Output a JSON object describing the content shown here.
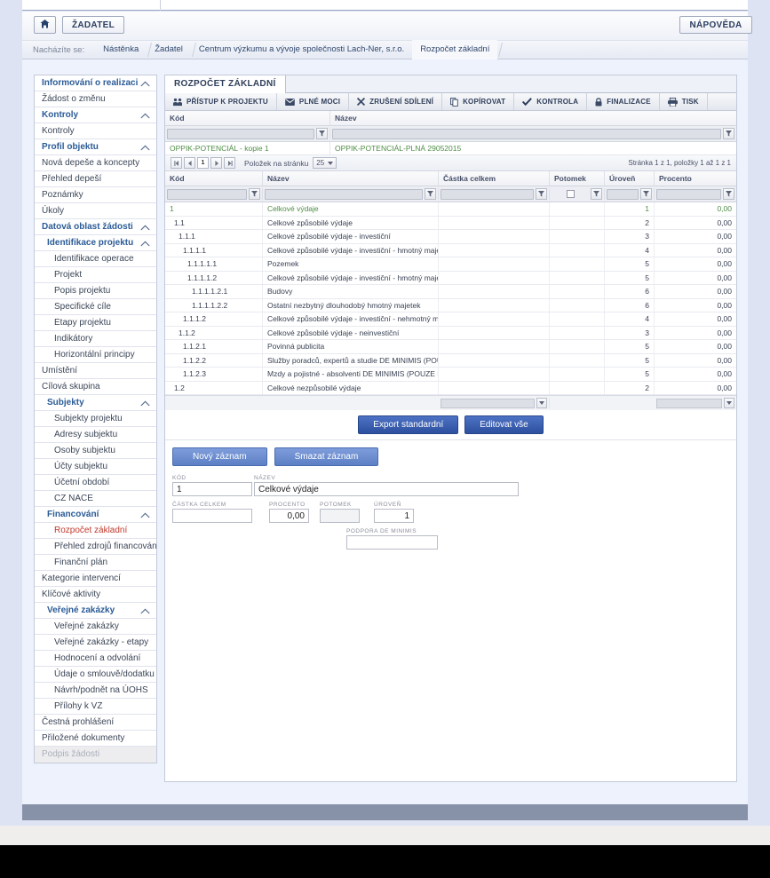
{
  "topbar": {
    "home_label": "⌂",
    "applicant_label": "ŽADATEL",
    "help_label": "NÁPOVĚDA"
  },
  "breadcrumb": {
    "label": "Nacházíte se:",
    "items": [
      "Nástěnka",
      "Žadatel",
      "Centrum výzkumu a vývoje společnosti Lach-Ner, s.r.o.",
      "Rozpočet základní"
    ]
  },
  "sidebar": {
    "items": [
      {
        "label": "Informování o realizaci",
        "type": "group",
        "chevron": true
      },
      {
        "label": "Žádost o změnu",
        "type": "item"
      },
      {
        "label": "Kontroly",
        "type": "group",
        "chevron": true
      },
      {
        "label": "Kontroly",
        "type": "item"
      },
      {
        "label": "Profil objektu",
        "type": "group",
        "chevron": true
      },
      {
        "label": "Nová depeše a koncepty",
        "type": "item"
      },
      {
        "label": "Přehled depeší",
        "type": "item"
      },
      {
        "label": "Poznámky",
        "type": "item"
      },
      {
        "label": "Úkoly",
        "type": "item"
      },
      {
        "label": "Datová oblast žádosti",
        "type": "group",
        "chevron": true
      },
      {
        "label": "Identifikace projektu",
        "type": "group-sub",
        "chevron": true
      },
      {
        "label": "Identifikace operace",
        "type": "sub"
      },
      {
        "label": "Projekt",
        "type": "sub"
      },
      {
        "label": "Popis projektu",
        "type": "sub"
      },
      {
        "label": "Specifické cíle",
        "type": "sub"
      },
      {
        "label": "Etapy projektu",
        "type": "sub"
      },
      {
        "label": "Indikátory",
        "type": "sub"
      },
      {
        "label": "Horizontální principy",
        "type": "sub"
      },
      {
        "label": "Umístění",
        "type": "item"
      },
      {
        "label": "Cílová skupina",
        "type": "item"
      },
      {
        "label": "Subjekty",
        "type": "group-sub",
        "chevron": true
      },
      {
        "label": "Subjekty projektu",
        "type": "sub"
      },
      {
        "label": "Adresy subjektu",
        "type": "sub"
      },
      {
        "label": "Osoby subjektu",
        "type": "sub"
      },
      {
        "label": "Účty subjektu",
        "type": "sub"
      },
      {
        "label": "Účetní období",
        "type": "sub"
      },
      {
        "label": "CZ NACE",
        "type": "sub"
      },
      {
        "label": "Financování",
        "type": "group-sub",
        "chevron": true
      },
      {
        "label": "Rozpočet základní",
        "type": "sub",
        "state": "active"
      },
      {
        "label": "Přehled zdrojů financování",
        "type": "sub"
      },
      {
        "label": "Finanční plán",
        "type": "sub"
      },
      {
        "label": "Kategorie intervencí",
        "type": "item"
      },
      {
        "label": "Klíčové aktivity",
        "type": "item"
      },
      {
        "label": "Veřejné zakázky",
        "type": "group-sub",
        "chevron": true
      },
      {
        "label": "Veřejné zakázky",
        "type": "sub"
      },
      {
        "label": "Veřejné zakázky - etapy",
        "type": "sub"
      },
      {
        "label": "Hodnocení a odvolání",
        "type": "sub"
      },
      {
        "label": "Údaje o smlouvě/dodatku",
        "type": "sub"
      },
      {
        "label": "Návrh/podnět na ÚOHS",
        "type": "sub"
      },
      {
        "label": "Přílohy k VZ",
        "type": "sub"
      },
      {
        "label": "Čestná prohlášení",
        "type": "item"
      },
      {
        "label": "Přiložené dokumenty",
        "type": "item"
      },
      {
        "label": "Podpis žádosti",
        "type": "item",
        "state": "disabled"
      }
    ]
  },
  "main": {
    "tab_label": "ROZPOČET ZÁKLADNÍ",
    "actions": [
      {
        "label": "PŘÍSTUP K PROJEKTU",
        "icon": "people-icon"
      },
      {
        "label": "PLNÉ MOCI",
        "icon": "envelope-icon"
      },
      {
        "label": "ZRUŠENÍ SDÍLENÍ",
        "icon": "x-icon"
      },
      {
        "label": "KOPÍROVAT",
        "icon": "copy-icon"
      },
      {
        "label": "KONTROLA",
        "icon": "check-icon"
      },
      {
        "label": "FINALIZACE",
        "icon": "lock-icon"
      },
      {
        "label": "TISK",
        "icon": "printer-icon"
      }
    ]
  },
  "top_grid": {
    "headers": [
      "Kód",
      "Název"
    ],
    "rows": [
      [
        "OPPIK-POTENCIÁL - kopie 1",
        "OPPIK-POTENCIÁL-PLNÁ 29052015"
      ]
    ]
  },
  "pager": {
    "first": "❘◀",
    "prev": "◀",
    "current": "1",
    "next": "▶",
    "last": "▶❘",
    "per_page_label": "Položek na stránku",
    "per_page_value": "25",
    "summary": "Stránka 1 z 1, položky 1 až 1 z 1"
  },
  "table": {
    "headers": [
      "Kód",
      "Název",
      "Částka celkem",
      "Potomek",
      "Úroveň",
      "Procento"
    ],
    "rows": [
      {
        "kod": "1",
        "nazev": "Celkové výdaje",
        "castka": "",
        "potomek": "",
        "uroven": "1",
        "procento": "0,00",
        "indent": 0
      },
      {
        "kod": "1.1",
        "nazev": "Celkové způsobilé výdaje",
        "castka": "",
        "potomek": "",
        "uroven": "2",
        "procento": "0,00",
        "indent": 1
      },
      {
        "kod": "1.1.1",
        "nazev": "Celkové způsobilé výdaje - investiční",
        "castka": "",
        "potomek": "",
        "uroven": "3",
        "procento": "0,00",
        "indent": 2
      },
      {
        "kod": "1.1.1.1",
        "nazev": "Celkové způsobilé výdaje - investiční - hmotný majetek",
        "castka": "",
        "potomek": "",
        "uroven": "4",
        "procento": "0,00",
        "indent": 3
      },
      {
        "kod": "1.1.1.1.1",
        "nazev": "Pozemek",
        "castka": "",
        "potomek": "",
        "uroven": "5",
        "procento": "0,00",
        "indent": 4
      },
      {
        "kod": "1.1.1.1.2",
        "nazev": "Celkové způsobilé výdaje - investiční - hmotný majetek (mi...",
        "castka": "",
        "potomek": "",
        "uroven": "5",
        "procento": "0,00",
        "indent": 4
      },
      {
        "kod": "1.1.1.1.2.1",
        "nazev": "Budovy",
        "castka": "",
        "potomek": "",
        "uroven": "6",
        "procento": "0,00",
        "indent": 5
      },
      {
        "kod": "1.1.1.1.2.2",
        "nazev": "Ostatní nezbytný dlouhodobý hmotný majetek",
        "castka": "",
        "potomek": "",
        "uroven": "6",
        "procento": "0,00",
        "indent": 5
      },
      {
        "kod": "1.1.1.2",
        "nazev": "Celkové způsobilé výdaje - investiční - nehmotný majetek",
        "castka": "",
        "potomek": "",
        "uroven": "4",
        "procento": "0,00",
        "indent": 3
      },
      {
        "kod": "1.1.2",
        "nazev": "Celkové způsobilé výdaje - neinvestiční",
        "castka": "",
        "potomek": "",
        "uroven": "3",
        "procento": "0,00",
        "indent": 2
      },
      {
        "kod": "1.1.2.1",
        "nazev": "Povinná publicita",
        "castka": "",
        "potomek": "",
        "uroven": "5",
        "procento": "0,00",
        "indent": 3
      },
      {
        "kod": "1.1.2.2",
        "nazev": "Služby poradců, expertů a studie DE MINIMIS (POUZE PRO...",
        "castka": "",
        "potomek": "",
        "uroven": "5",
        "procento": "0,00",
        "indent": 3
      },
      {
        "kod": "1.1.2.3",
        "nazev": "Mzdy a pojistné - absolventi DE MINIMIS (POUZE PRO MSP)",
        "castka": "",
        "potomek": "",
        "uroven": "5",
        "procento": "0,00",
        "indent": 3
      },
      {
        "kod": "1.2",
        "nazev": "Celkové nezpůsobilé výdaje",
        "castka": "",
        "potomek": "",
        "uroven": "2",
        "procento": "0,00",
        "indent": 1
      }
    ]
  },
  "buttons": {
    "export": "Export standardní",
    "edit_all": "Editovat vše",
    "new_record": "Nový záznam",
    "delete_record": "Smazat záznam"
  },
  "form": {
    "kod_label": "KÓD",
    "kod_value": "1",
    "nazev_label": "NÁZEV",
    "nazev_value": "Celkové výdaje",
    "castka_label": "ČÁSTKA CELKEM",
    "castka_value": "",
    "procento_label": "PROCENTO",
    "procento_value": "0,00",
    "potomek_label": "POTOMEK",
    "potomek_value": "",
    "uroven_label": "ÚROVEŇ",
    "uroven_value": "1",
    "deminimis_label": "PODPORA DE MINIMIS",
    "deminimis_value": ""
  }
}
